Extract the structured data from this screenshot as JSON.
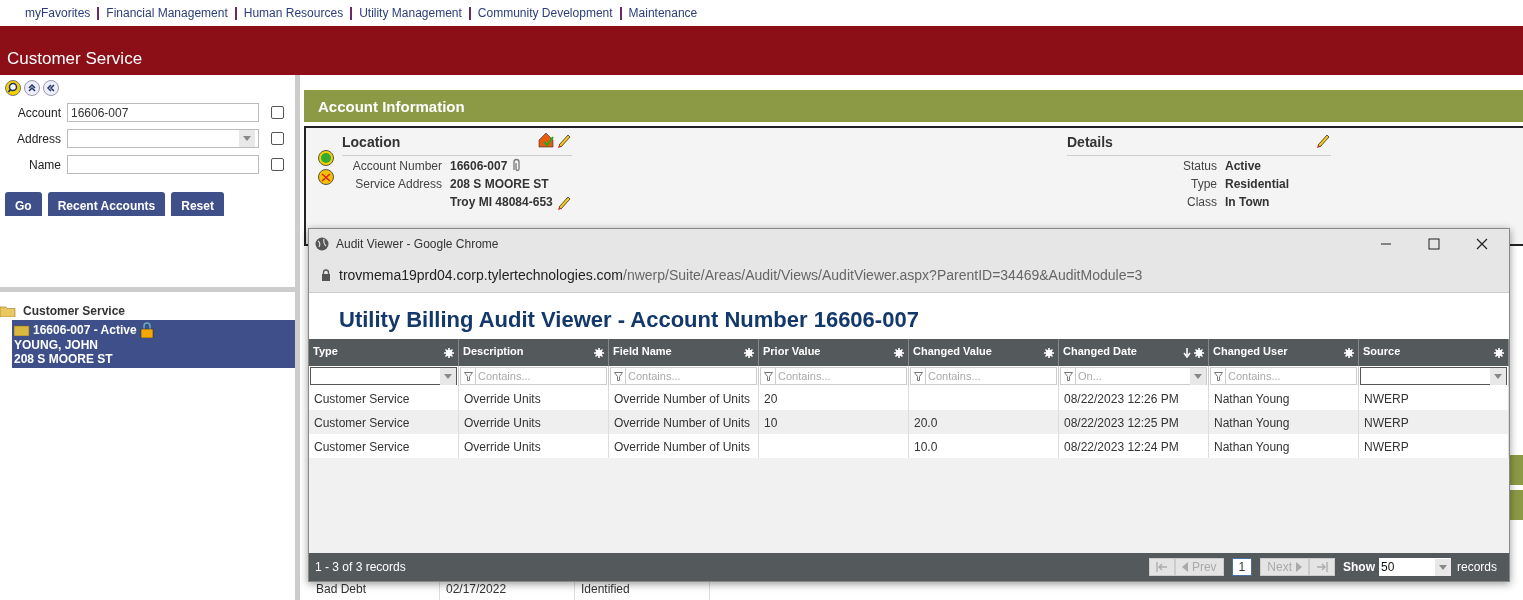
{
  "top_nav": [
    "myFavorites",
    "Financial Management",
    "Human Resources",
    "Utility Management",
    "Community Development",
    "Maintenance"
  ],
  "banner": {
    "title": "Customer Service"
  },
  "search_panel": {
    "fields": [
      {
        "label": "Account",
        "kind": "text",
        "value": "16606-007",
        "checked": false
      },
      {
        "label": "Address",
        "kind": "select",
        "checked": false
      },
      {
        "label": "Name",
        "kind": "text",
        "checked": false
      }
    ],
    "buttons": [
      "Go",
      "Recent Accounts",
      "Reset"
    ]
  },
  "tree": {
    "label": "Customer Service",
    "children": [
      {
        "label": "16606-007 - Active",
        "lines": [
          "YOUNG, JOHN",
          "208 S MOORE ST"
        ],
        "selected": true
      }
    ]
  },
  "account_info": {
    "title": "Account Information",
    "location": {
      "title": "Location",
      "rows": [
        {
          "label": "Account Number",
          "value": "16606-007"
        },
        {
          "label": "Service Address",
          "value": "208 S MOORE ST"
        },
        {
          "label": "",
          "value": "Troy MI 48084-653"
        }
      ]
    },
    "details": {
      "title": "Details",
      "rows": [
        {
          "label": "Status",
          "value": "Active"
        },
        {
          "label": "Type",
          "value": "Residential"
        },
        {
          "label": "Class",
          "value": "In Town"
        }
      ]
    }
  },
  "background_table": {
    "row": [
      "Bad Debt",
      "02/17/2022",
      "Identified"
    ]
  },
  "popup": {
    "window_title": "Audit Viewer - Google Chrome",
    "url_host": "trovmema19prd04.corp.tylertechnologies.com",
    "url_path": "/nwerp/Suite/Areas/Audit/Views/AuditViewer.aspx?ParentID=34469&AuditModule=3",
    "heading": "Utility Billing Audit Viewer - Account Number 16606-007",
    "columns": [
      {
        "label": "Type",
        "sorted": false,
        "filter": {
          "kind": "select"
        }
      },
      {
        "label": "Description",
        "sorted": false,
        "filter": {
          "kind": "text",
          "placeholder": "Contains..."
        }
      },
      {
        "label": "Field Name",
        "sorted": false,
        "filter": {
          "kind": "text",
          "placeholder": "Contains..."
        }
      },
      {
        "label": "Prior Value",
        "sorted": false,
        "filter": {
          "kind": "text",
          "placeholder": "Contains..."
        }
      },
      {
        "label": "Changed Value",
        "sorted": false,
        "filter": {
          "kind": "text",
          "placeholder": "Contains..."
        }
      },
      {
        "label": "Changed Date",
        "sorted": true,
        "filter": {
          "kind": "date",
          "placeholder": "On..."
        }
      },
      {
        "label": "Changed User",
        "sorted": false,
        "filter": {
          "kind": "text",
          "placeholder": "Contains..."
        }
      },
      {
        "label": "Source",
        "sorted": false,
        "filter": {
          "kind": "select"
        }
      }
    ],
    "rows": [
      [
        "Customer Service",
        "Override Units",
        "Override Number of Units",
        "20",
        "",
        "08/22/2023 12:26 PM",
        "Nathan Young",
        "NWERP"
      ],
      [
        "Customer Service",
        "Override Units",
        "Override Number of Units",
        "10",
        "20.0",
        "08/22/2023 12:25 PM",
        "Nathan Young",
        "NWERP"
      ],
      [
        "Customer Service",
        "Override Units",
        "Override Number of Units",
        "",
        "10.0",
        "08/22/2023 12:24 PM",
        "Nathan Young",
        "NWERP"
      ]
    ],
    "footer": {
      "summary": "1 - 3 of 3 records",
      "pager": [
        {
          "kind": "first",
          "disabled": true
        },
        {
          "kind": "prev",
          "label": "Prev",
          "disabled": true
        },
        {
          "kind": "page",
          "label": "1",
          "disabled": false
        },
        {
          "kind": "next",
          "label": "Next",
          "disabled": true
        },
        {
          "kind": "last",
          "disabled": true
        }
      ],
      "show_label": "Show",
      "page_size": "50",
      "records_label": "records"
    }
  }
}
